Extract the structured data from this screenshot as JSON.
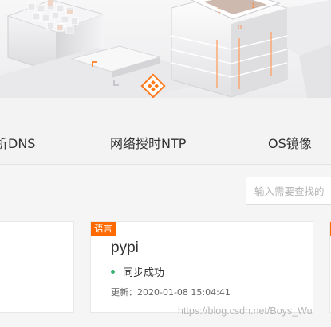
{
  "tabs": [
    {
      "label": "析DNS"
    },
    {
      "label": "网络授时NTP"
    },
    {
      "label": "OS镜像"
    }
  ],
  "search": {
    "placeholder": "输入需要查找的"
  },
  "cards": {
    "main": {
      "badge": "语言",
      "title": "pypi",
      "status": "同步成功",
      "updated": "更新：2020-01-08 15:04:41"
    }
  },
  "watermark": "https://blog.csdn.net/Boys_Wu",
  "colors": {
    "accent": "#ff6a00",
    "status_ok": "#3cb371",
    "page_bg": "#f5f5f5"
  }
}
